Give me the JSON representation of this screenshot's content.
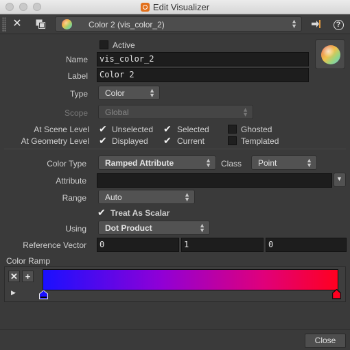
{
  "window": {
    "title": "Edit Visualizer"
  },
  "toolbar": {
    "close_symbol": "✕",
    "copy_icon": "copy-icon",
    "visualizer_name": "Color 2 (vis_color_2)",
    "pin_icon": "pin-icon",
    "help_symbol": "?"
  },
  "form": {
    "active": {
      "label": "Active",
      "checked": false
    },
    "name": {
      "label": "Name",
      "value": "vis_color_2"
    },
    "label": {
      "label": "Label",
      "value": "Color 2"
    },
    "type": {
      "label": "Type",
      "value": "Color"
    },
    "scope": {
      "label": "Scope",
      "value": "Global",
      "disabled": true
    },
    "scene_level": {
      "label": "At Scene Level",
      "options": [
        {
          "label": "Unselected",
          "checked": true
        },
        {
          "label": "Selected",
          "checked": true
        },
        {
          "label": "Ghosted",
          "checked": false
        }
      ]
    },
    "geometry_level": {
      "label": "At Geometry Level",
      "options": [
        {
          "label": "Displayed",
          "checked": true
        },
        {
          "label": "Current",
          "checked": true
        },
        {
          "label": "Templated",
          "checked": false
        }
      ]
    },
    "color_type": {
      "label": "Color Type",
      "value": "Ramped Attribute"
    },
    "class": {
      "label": "Class",
      "value": "Point"
    },
    "attribute": {
      "label": "Attribute",
      "value": ""
    },
    "range": {
      "label": "Range",
      "value": "Auto"
    },
    "treat_as_scalar": {
      "label": "Treat As Scalar",
      "checked": true
    },
    "using": {
      "label": "Using",
      "value": "Dot Product"
    },
    "reference_vector": {
      "label": "Reference Vector",
      "values": [
        "0",
        "1",
        "0"
      ]
    },
    "color_ramp": {
      "label": "Color Ramp",
      "remove_symbol": "✕",
      "add_symbol": "+",
      "start_color": "#1a10ff",
      "end_color": "#ff0020"
    }
  },
  "footer": {
    "close_label": "Close"
  }
}
